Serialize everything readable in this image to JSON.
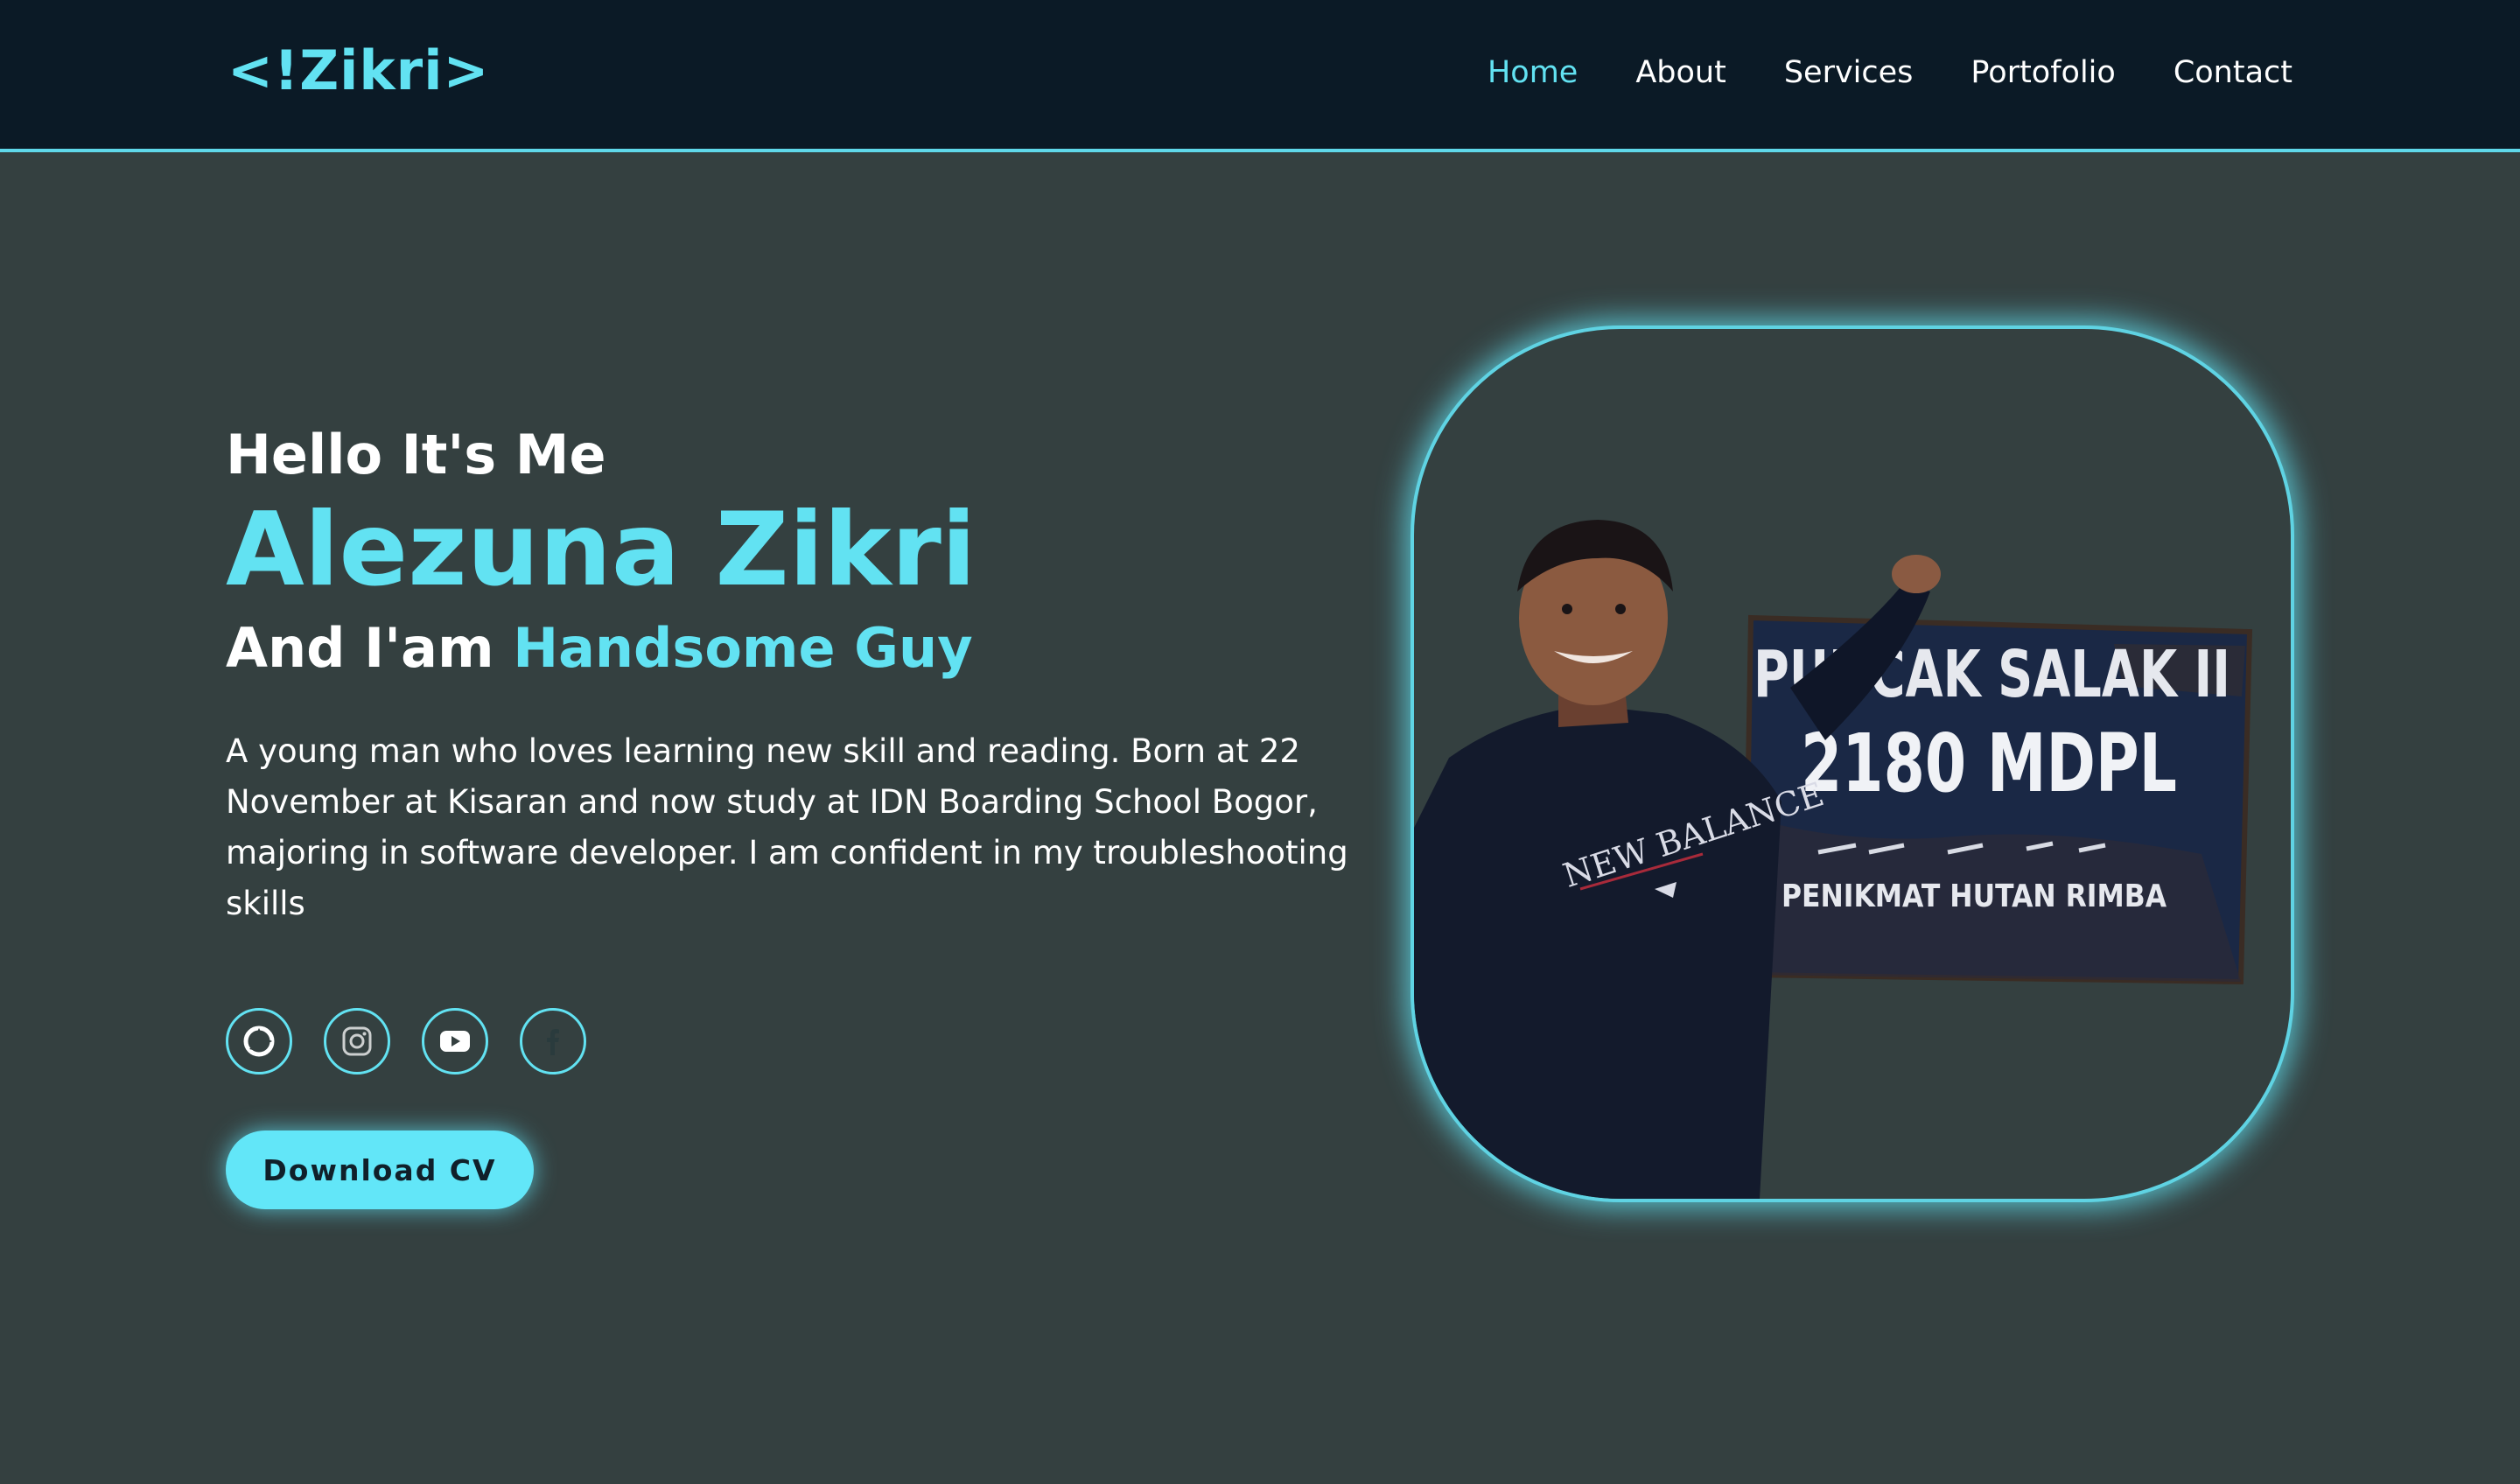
{
  "header": {
    "logo": "<!Zikri>",
    "nav": [
      "Home",
      "About",
      "Services",
      "Portofolio",
      "Contact"
    ],
    "active_nav": "Home"
  },
  "hero": {
    "greeting": "Hello It's Me",
    "name": "Alezuna Zikri",
    "tagline_prefix": "And I'am",
    "tagline_highlight": "Handsome Guy",
    "description": "A young man who loves learning new skill and reading. Born at 22 November at Kisaran and now study at IDN Boarding School Bogor, majoring in software developer. I am confident in my troubleshooting skills",
    "socials": [
      "globe-icon",
      "instagram-icon",
      "youtube-icon",
      "facebook-icon"
    ],
    "cv_button": "Download CV"
  },
  "photo": {
    "sign_line1": "PUNCAK SALAK II",
    "sign_line2": "2180 MDPL",
    "sign_line3": "PENIKMAT HUTAN RIMBA",
    "shirt_text": "NEW BALANCE"
  },
  "colors": {
    "accent": "#62e2f2",
    "background": "#344040",
    "navbar": "#0b1a26"
  }
}
